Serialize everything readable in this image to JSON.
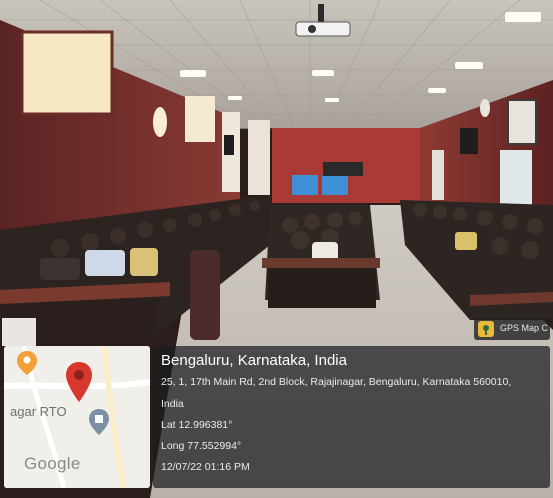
{
  "scene": {
    "description_icons": [
      "projector-icon",
      "ceiling-light-icon"
    ]
  },
  "map": {
    "place_label": "agar RTO",
    "logo_text": "Google",
    "marker_color": "#d8372e",
    "pin_color": "#f2a13a"
  },
  "geotag": {
    "city": "Bengaluru, Karnataka, India",
    "address_line1": "25, 1, 17th Main Rd, 2nd Block, Rajajinagar, Bengaluru, Karnataka 560010,",
    "address_line2": "India",
    "latitude": "Lat 12.996381°",
    "longitude": "Long 77.552994°",
    "datetime": "12/07/22 01:16 PM"
  },
  "app_badge": {
    "label": "GPS Map Camera"
  }
}
